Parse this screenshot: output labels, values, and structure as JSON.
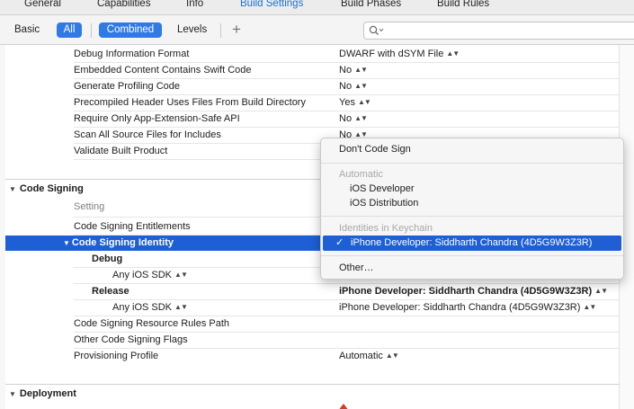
{
  "tabs": [
    {
      "label": "General",
      "active": false
    },
    {
      "label": "Capabilities",
      "active": false
    },
    {
      "label": "Info",
      "active": false
    },
    {
      "label": "Build Settings",
      "active": true
    },
    {
      "label": "Build Phases",
      "active": false
    },
    {
      "label": "Build Rules",
      "active": false
    }
  ],
  "filter": {
    "basic": "Basic",
    "all": "All",
    "combined": "Combined",
    "levels": "Levels",
    "add": "+",
    "search_placeholder": ""
  },
  "build_options": [
    {
      "label": "Debug Information Format",
      "value": "DWARF with dSYM File"
    },
    {
      "label": "Embedded Content Contains Swift Code",
      "value": "No"
    },
    {
      "label": "Generate Profiling Code",
      "value": "No"
    },
    {
      "label": "Precompiled Header Uses Files From Build Directory",
      "value": "Yes"
    },
    {
      "label": "Require Only App-Extension-Safe API",
      "value": "No"
    },
    {
      "label": "Scan All Source Files for Includes",
      "value": "No"
    },
    {
      "label": "Validate Built Product",
      "value": ""
    }
  ],
  "code_signing": {
    "title": "Code Signing",
    "setting_header": "Setting",
    "entitlements": "Code Signing Entitlements",
    "identity": "Code Signing Identity",
    "debug": "Debug",
    "debug_sdk": "Any iOS SDK",
    "release": "Release",
    "release_value": "iPhone Developer: Siddharth Chandra (4D5G9W3Z3R)",
    "release_sdk": "Any iOS SDK",
    "release_sdk_value": "iPhone Developer: Siddharth Chandra (4D5G9W3Z3R)",
    "resource_rules": "Code Signing Resource Rules Path",
    "other_flags": "Other Code Signing Flags",
    "provisioning": "Provisioning Profile",
    "provisioning_value": "Automatic"
  },
  "deployment": {
    "title": "Deployment"
  },
  "menu": {
    "dont_sign": "Don't Code Sign",
    "automatic_header": "Automatic",
    "ios_developer": "iOS Developer",
    "ios_distribution": "iOS Distribution",
    "keychain_header": "Identities in Keychain",
    "selected_identity": "iPhone Developer: Siddharth Chandra (4D5G9W3Z3R)",
    "other": "Other…"
  },
  "colors": {
    "accent": "#2f7ae5",
    "selection": "#1e5fd6",
    "tab_active": "#1670d8"
  }
}
